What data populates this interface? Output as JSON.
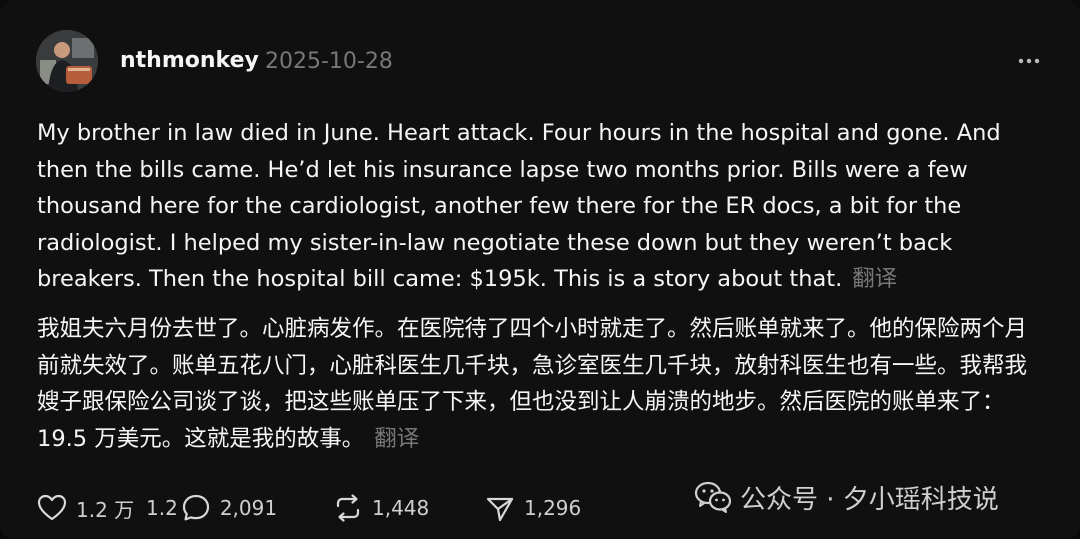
{
  "post": {
    "username": "nthmonkey",
    "date": "2025-10-28",
    "text_en": "My brother in law died in June. Heart attack. Four hours in the hospital and gone. And then the bills came. He’d let his insurance lapse two months prior. Bills were a few thousand here for the cardiologist, another few there for the ER docs, a bit for the radiologist. I helped my sister-in-law negotiate these down but they weren’t back breakers. Then the hospital bill came: $195k. This is a story about that.",
    "text_zh": "我姐夫六月份去世了。心脏病发作。在医院待了四个小时就走了。然后账单就来了。他的保险两个月前就失效了。账单五花八门，心脏科医生几千块，急诊室医生几千块，放射科医生也有一些。我帮我嫂子跟保险公司谈了谈，把这些账单压了下来，但也没到让人崩溃的地步。然后医院的账单来了：19.5 万美元。这就是我的故事。",
    "translate_label": "翻译"
  },
  "actions": {
    "likes": "1.2 万",
    "comments": "1.2",
    "comment_count_overlap": "2,091",
    "reposts": "1,448",
    "shares": "1,296"
  },
  "watermark": {
    "text": "公众号 · 夕小瑶科技说"
  },
  "icons": {
    "more": "more-horizontal-icon",
    "like": "heart-icon",
    "comment": "comment-bubble-icon",
    "repost": "repost-icon",
    "share": "send-icon",
    "wechat": "wechat-icon"
  },
  "colors": {
    "background": "#101010",
    "text": "#f3f5f7",
    "muted": "#777777"
  }
}
